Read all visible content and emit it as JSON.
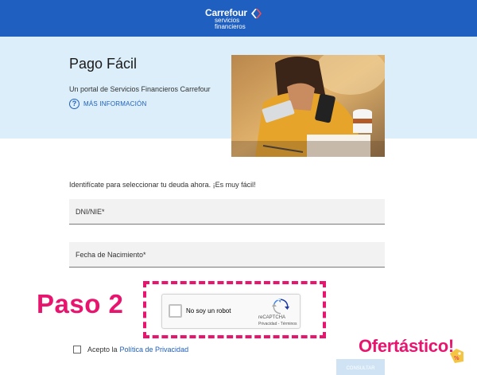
{
  "header": {
    "brand": "Carrefour",
    "subtitle_line1": "servicios",
    "subtitle_line2": "financieros",
    "logo_icon": "carrefour-mark-icon",
    "bg_color": "#1e5fbf"
  },
  "hero": {
    "title": "Pago Fácil",
    "subtitle": "Un portal de Servicios Financieros Carrefour",
    "more_info_label": "MÁS INFORMACIÓN",
    "help_icon": "question-circle-icon",
    "bg_color": "#dbeefa"
  },
  "form": {
    "intro": "Identifícate para seleccionar tu deuda ahora. ¡Es muy fácil!",
    "dni_placeholder": "DNI/NIE*",
    "birth_placeholder": "Fecha de Nacimiento*",
    "privacy_prefix": "Acepto la",
    "privacy_link": "Política de Privacidad",
    "submit_label": "CONSULTAR"
  },
  "recaptcha": {
    "label": "No soy un robot",
    "brand": "reCAPTCHA",
    "links": "Privacidad - Términos"
  },
  "annotation": {
    "step_label": "Paso 2",
    "accent_color": "#e8156f"
  },
  "watermark": {
    "text": "Ofertástico!",
    "tag_text": "%"
  }
}
